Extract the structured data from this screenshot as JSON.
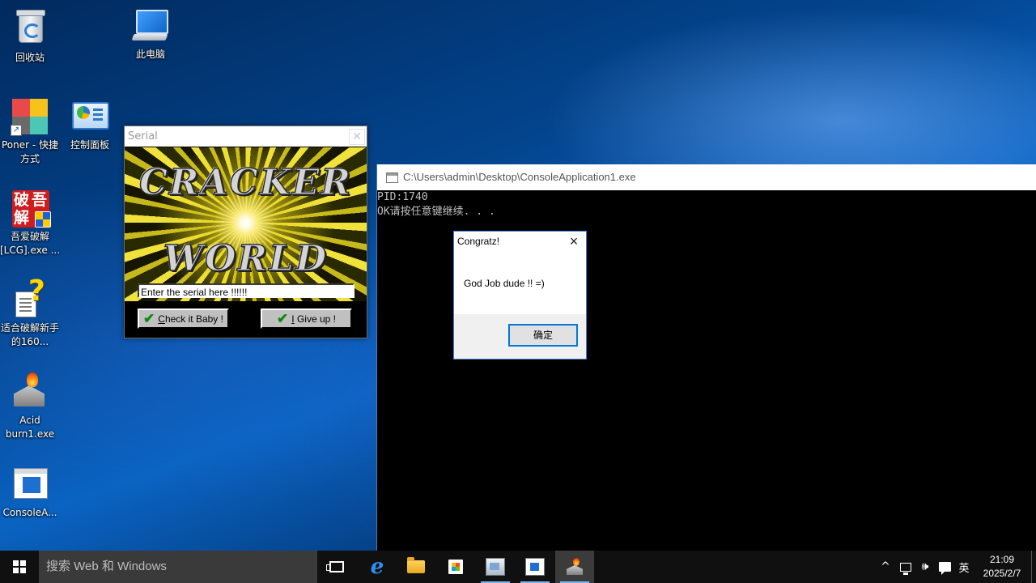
{
  "desktop": {
    "icons": [
      {
        "label": "回收站"
      },
      {
        "label": "此电脑"
      },
      {
        "label": "Poner - 快捷方式"
      },
      {
        "label": "控制面板"
      },
      {
        "label": "吾爱破解[LCG].exe ..."
      },
      {
        "label": "适合破解新手的160..."
      },
      {
        "label": "Acid burn1.exe"
      },
      {
        "label": "ConsoleA..."
      }
    ],
    "icon_52pojie_glyphs": [
      "破",
      "吾",
      "解"
    ]
  },
  "serial_window": {
    "title": "Serial",
    "banner_line1": "CRACKER",
    "banner_line2": "WORLD",
    "input_value": "Enter the serial here !!!!!!",
    "check_button_underlined": "C",
    "check_button_rest": "heck it Baby !",
    "give_button_underlined": "I",
    "give_button_rest": " Give up !"
  },
  "console_window": {
    "title": "C:\\Users\\admin\\Desktop\\ConsoleApplication1.exe",
    "lines": [
      "PID:1740",
      "OK请按任意键继续. . ."
    ]
  },
  "message_box": {
    "title": "Congratz!",
    "message": "God Job dude !! =)",
    "ok_label": "确定"
  },
  "taskbar": {
    "search_placeholder": "搜索 Web 和 Windows",
    "tray_chevron": "^",
    "tray_volume": "🕪",
    "ime_label": "英",
    "time": "21:09",
    "date": "2025/2/7"
  },
  "colors": {
    "accent": "#0078d7",
    "desktop_blue": "#03458f",
    "taskbar": "#101010",
    "check_green": "#0c8a13"
  }
}
